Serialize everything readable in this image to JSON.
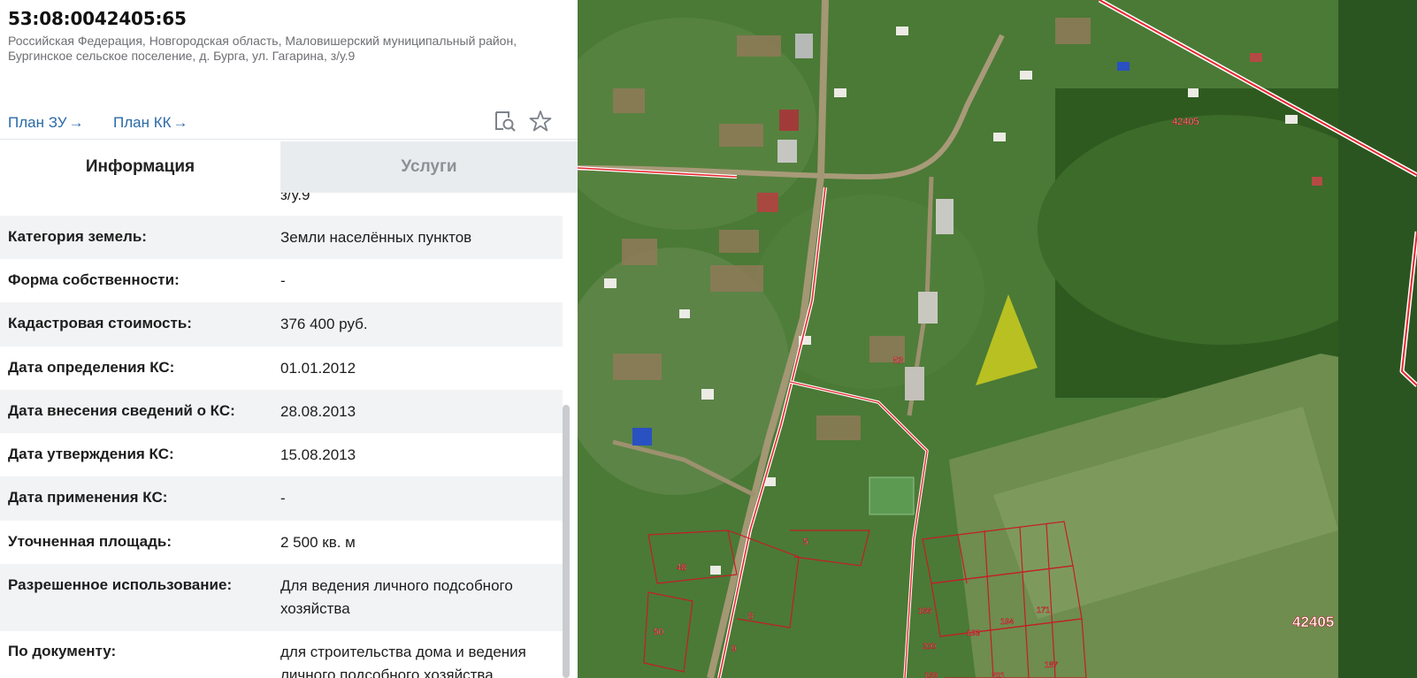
{
  "header": {
    "cadastral_number": "53:08:0042405:65",
    "address": "Российская Федерация, Новгородская область, Маловишерский муниципальный район, Бургинское сельское поселение, д. Бурга, ул. Гагарина, з/у.9",
    "links": [
      {
        "label": "План ЗУ",
        "arrow": "→"
      },
      {
        "label": "План КК",
        "arrow": "→"
      }
    ],
    "icons": [
      "document-search-icon",
      "star-icon"
    ]
  },
  "tabs": [
    {
      "label": "Информация",
      "active": true
    },
    {
      "label": "Услуги",
      "active": false
    }
  ],
  "info": {
    "address_tail": "з/у.9",
    "rows": [
      {
        "label": "Категория земель:",
        "value": "Земли населённых пунктов"
      },
      {
        "label": "Форма собственности:",
        "value": "-"
      },
      {
        "label": "Кадастровая стоимость:",
        "value": "376 400 руб."
      },
      {
        "label": "Дата определения КС:",
        "value": "01.01.2012"
      },
      {
        "label": "Дата внесения сведений о КС:",
        "value": "28.08.2013"
      },
      {
        "label": "Дата утверждения КС:",
        "value": "15.08.2013"
      },
      {
        "label": "Дата применения КС:",
        "value": "-"
      },
      {
        "label": "Уточненная площадь:",
        "value": "2 500 кв. м"
      },
      {
        "label": "Разрешенное использование:",
        "value": "Для ведения личного подсобного хозяйства"
      },
      {
        "label": "По документу:",
        "value": "для строительства дома и ведения личного подсобного хозяйства"
      }
    ]
  },
  "map": {
    "highlight_color": "#d4d21e",
    "boundary_color": "#e8262f",
    "labels": [
      "42405",
      "42405",
      "53",
      "5",
      "48",
      "50",
      "8",
      "9",
      "166",
      "193",
      "194",
      "171",
      "200",
      "201",
      "187",
      "169"
    ]
  }
}
